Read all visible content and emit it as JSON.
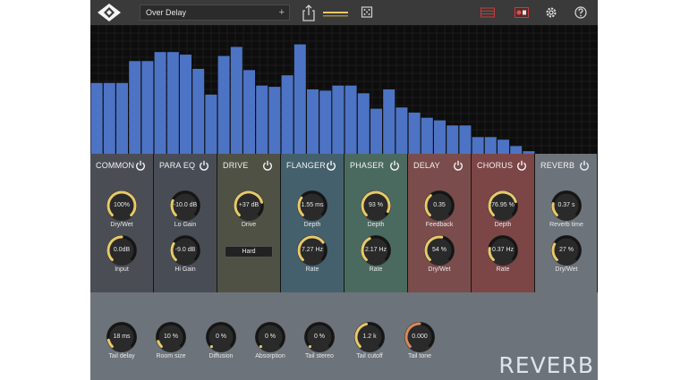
{
  "preset": {
    "name": "Over Delay",
    "add_symbol": "+"
  },
  "colors": {
    "accent": "#e8c96a",
    "bar": "#4d73c4",
    "module_common": "#4a4e54",
    "module_paraeq": "#484d55",
    "module_drive": "#4f5144",
    "module_flanger": "#45606d",
    "module_phaser": "#4b6a5f",
    "module_delay": "#7b4c4c",
    "module_chorus": "#7c4647",
    "module_reverb": "#6d737a"
  },
  "spectrum": {
    "levels": [
      0.55,
      0.55,
      0.55,
      0.72,
      0.72,
      0.79,
      0.79,
      0.77,
      0.66,
      0.46,
      0.76,
      0.83,
      0.65,
      0.53,
      0.52,
      0.61,
      0.85,
      0.5,
      0.49,
      0.53,
      0.53,
      0.47,
      0.35,
      0.5,
      0.36,
      0.32,
      0.28,
      0.26,
      0.22,
      0.22,
      0.13,
      0.13,
      0.11,
      0.06,
      0.02
    ]
  },
  "modules": [
    {
      "id": "common",
      "title": "COMMON",
      "knobs": [
        {
          "value": "100%",
          "label": "Dry/Wet",
          "fill": 1.0,
          "color": "accent"
        },
        {
          "value": "0.0dB",
          "label": "Input",
          "fill": 0.5,
          "color": "accent"
        }
      ]
    },
    {
      "id": "paraeq",
      "title": "PARA EQ",
      "knobs": [
        {
          "value": "-10.0 dB",
          "label": "Lo Gain",
          "fill": 0.25,
          "color": "accent"
        },
        {
          "value": "-9.0 dB",
          "label": "Hi Gain",
          "fill": 0.28,
          "color": "accent"
        }
      ]
    },
    {
      "id": "drive",
      "title": "DRIVE",
      "knobs": [
        {
          "value": "+37 dB",
          "label": "Drive",
          "fill": 0.78,
          "color": "accent"
        }
      ],
      "mode": "Hard"
    },
    {
      "id": "flanger",
      "title": "FLANGER",
      "knobs": [
        {
          "value": "1.55 ms",
          "label": "Depth",
          "fill": 0.3,
          "color": "accent"
        },
        {
          "value": "7.27 Hz",
          "label": "Rate",
          "fill": 0.7,
          "color": "accent"
        }
      ]
    },
    {
      "id": "phaser",
      "title": "PHASER",
      "knobs": [
        {
          "value": "93 %",
          "label": "Depth",
          "fill": 0.93,
          "color": "accent"
        },
        {
          "value": "2.17 Hz",
          "label": "Rate",
          "fill": 0.4,
          "color": "accent"
        }
      ]
    },
    {
      "id": "delay",
      "title": "DELAY",
      "knobs": [
        {
          "value": "0.35",
          "label": "Feedback",
          "fill": 0.35,
          "color": "accent"
        },
        {
          "value": "54 %",
          "label": "Dry/Wet",
          "fill": 0.54,
          "color": "accent"
        }
      ]
    },
    {
      "id": "chorus",
      "title": "CHORUS",
      "knobs": [
        {
          "value": "76.95 %",
          "label": "Depth",
          "fill": 0.77,
          "color": "accent"
        },
        {
          "value": "0.37 Hz",
          "label": "Rate",
          "fill": 0.2,
          "color": "accent"
        }
      ]
    },
    {
      "id": "reverb",
      "title": "REVERB",
      "knobs": [
        {
          "value": "0.37 s",
          "label": "Reverb time",
          "fill": 0.2,
          "color": "accent"
        },
        {
          "value": "27 %",
          "label": "Dry/Wet",
          "fill": 0.27,
          "color": "accent"
        }
      ]
    }
  ],
  "reverb_params": [
    {
      "value": "18 ms",
      "label": "Tail delay",
      "fill": 0.12,
      "color": "accent"
    },
    {
      "value": "10 %",
      "label": "Room size",
      "fill": 0.1,
      "color": "accent"
    },
    {
      "value": "0 %",
      "label": "Diffusion",
      "fill": 0.0,
      "color": "accent"
    },
    {
      "value": "0 %",
      "label": "Absorption",
      "fill": 0.0,
      "color": "accent"
    },
    {
      "value": "0 %",
      "label": "Tail stereo",
      "fill": 0.0,
      "color": "accent"
    },
    {
      "value": "1.2 k",
      "label": "Tail cutoff",
      "fill": 0.45,
      "color": "accent"
    },
    {
      "value": "0.000",
      "label": "Tail tone",
      "fill": 0.5,
      "color": "#d9895a"
    }
  ],
  "reverb_banner": "REVERB"
}
